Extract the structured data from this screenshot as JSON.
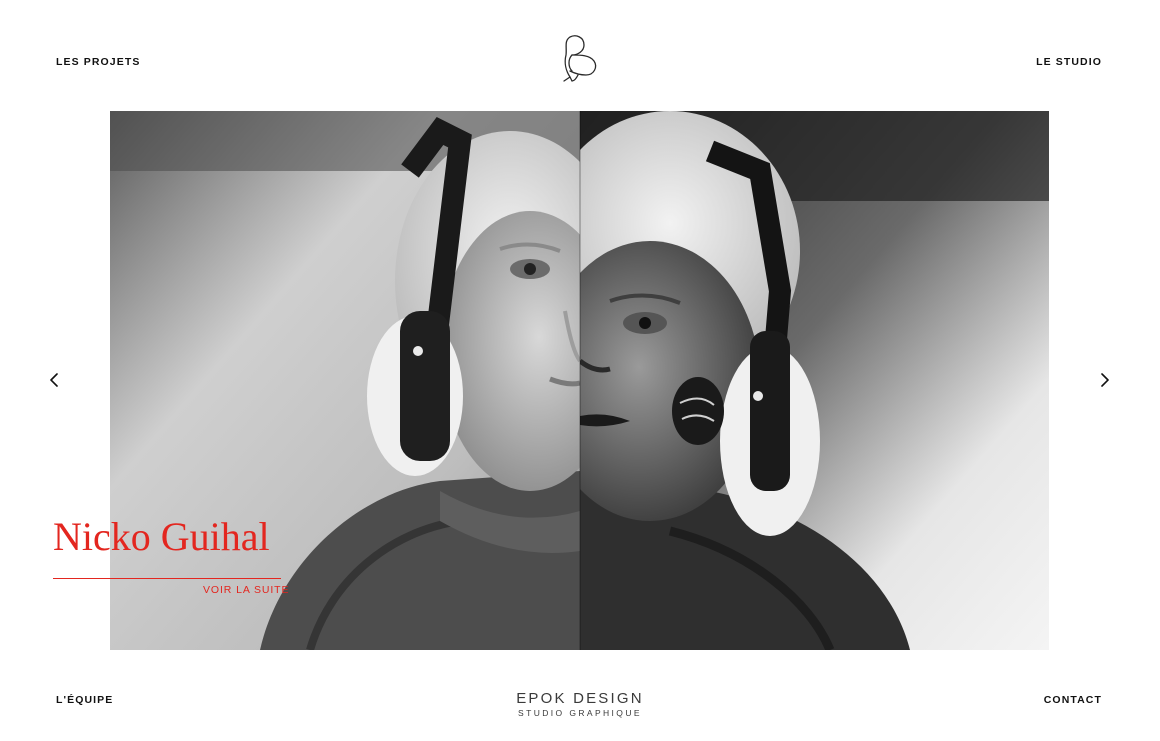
{
  "nav": {
    "projects": "LES PROJETS",
    "studio": "LE STUDIO",
    "team": "L'ÉQUIPE",
    "contact": "CONTACT"
  },
  "slide": {
    "title": "Nicko Guihal",
    "more": "VOIR LA SUITE"
  },
  "brand": {
    "name": "EPOK DESIGN",
    "tagline": "STUDIO GRAPHIQUE"
  },
  "icons": {
    "logo": "epok-logo-icon",
    "prev": "chevron-left-icon",
    "next": "chevron-right-icon"
  },
  "colors": {
    "accent": "#e3261f",
    "text": "#111111",
    "brand_text": "#3a3a3a",
    "background": "#ffffff"
  }
}
